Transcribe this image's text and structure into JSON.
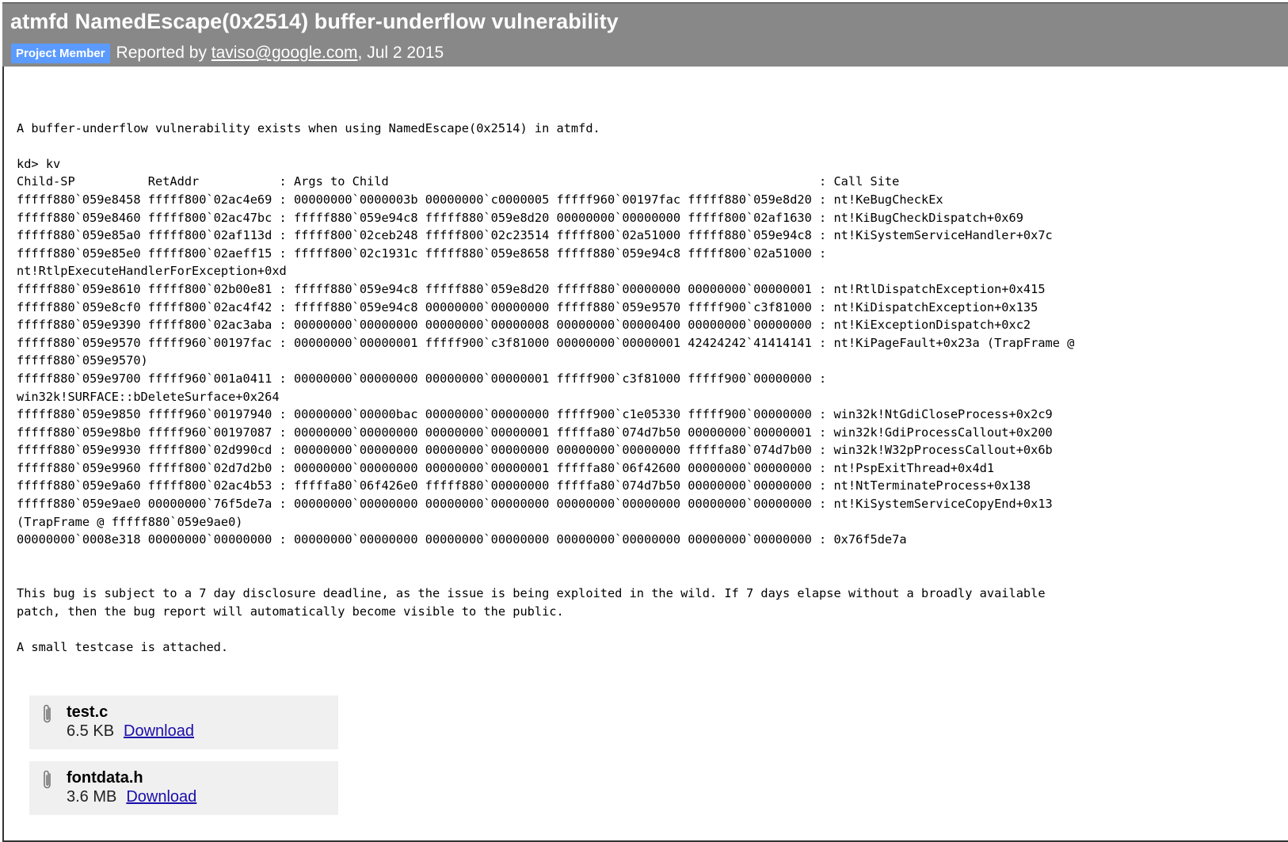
{
  "header": {
    "title": "atmfd NamedEscape(0x2514) buffer-underflow vulnerability",
    "badge": "Project Member",
    "reported_by_prefix": "Reported by",
    "reporter": "taviso@google.com",
    "date_suffix": ", Jul 2 2015"
  },
  "report": {
    "lines": [
      "",
      "A buffer-underflow vulnerability exists when using NamedEscape(0x2514) in atmfd.",
      "",
      "kd> kv",
      "Child-SP          RetAddr           : Args to Child                                                           : Call Site",
      "fffff880`059e8458 fffff800`02ac4e69 : 00000000`0000003b 00000000`c0000005 fffff960`00197fac fffff880`059e8d20 : nt!KeBugCheckEx",
      "fffff880`059e8460 fffff800`02ac47bc : fffff880`059e94c8 fffff880`059e8d20 00000000`00000000 fffff800`02af1630 : nt!KiBugCheckDispatch+0x69",
      "fffff880`059e85a0 fffff800`02af113d : fffff800`02ceb248 fffff800`02c23514 fffff800`02a51000 fffff880`059e94c8 : nt!KiSystemServiceHandler+0x7c",
      "fffff880`059e85e0 fffff800`02aeff15 : fffff800`02c1931c fffff880`059e8658 fffff880`059e94c8 fffff800`02a51000 :",
      "nt!RtlpExecuteHandlerForException+0xd",
      "fffff880`059e8610 fffff800`02b00e81 : fffff880`059e94c8 fffff880`059e8d20 fffff880`00000000 00000000`00000001 : nt!RtlDispatchException+0x415",
      "fffff880`059e8cf0 fffff800`02ac4f42 : fffff880`059e94c8 00000000`00000000 fffff880`059e9570 fffff900`c3f81000 : nt!KiDispatchException+0x135",
      "fffff880`059e9390 fffff800`02ac3aba : 00000000`00000000 00000000`00000008 00000000`00000400 00000000`00000000 : nt!KiExceptionDispatch+0xc2",
      "fffff880`059e9570 fffff960`00197fac : 00000000`00000001 fffff900`c3f81000 00000000`00000001 42424242`41414141 : nt!KiPageFault+0x23a (TrapFrame @",
      "fffff880`059e9570)",
      "fffff880`059e9700 fffff960`001a0411 : 00000000`00000000 00000000`00000001 fffff900`c3f81000 fffff900`00000000 :",
      "win32k!SURFACE::bDeleteSurface+0x264",
      "fffff880`059e9850 fffff960`00197940 : 00000000`00000bac 00000000`00000000 fffff900`c1e05330 fffff900`00000000 : win32k!NtGdiCloseProcess+0x2c9",
      "fffff880`059e98b0 fffff960`00197087 : 00000000`00000000 00000000`00000001 fffffa80`074d7b50 00000000`00000001 : win32k!GdiProcessCallout+0x200",
      "fffff880`059e9930 fffff800`02d990cd : 00000000`00000000 00000000`00000000 00000000`00000000 fffffa80`074d7b00 : win32k!W32pProcessCallout+0x6b",
      "fffff880`059e9960 fffff800`02d7d2b0 : 00000000`00000000 00000000`00000001 fffffa80`06f42600 00000000`00000000 : nt!PspExitThread+0x4d1",
      "fffff880`059e9a60 fffff800`02ac4b53 : fffffa80`06f426e0 fffff880`00000000 fffffa80`074d7b50 00000000`00000000 : nt!NtTerminateProcess+0x138",
      "fffff880`059e9ae0 00000000`76f5de7a : 00000000`00000000 00000000`00000000 00000000`00000000 00000000`00000000 : nt!KiSystemServiceCopyEnd+0x13",
      "(TrapFrame @ fffff880`059e9ae0)",
      "00000000`0008e318 00000000`00000000 : 00000000`00000000 00000000`00000000 00000000`00000000 00000000`00000000 : 0x76f5de7a",
      "",
      "",
      "This bug is subject to a 7 day disclosure deadline, as the issue is being exploited in the wild. If 7 days elapse without a broadly available",
      "patch, then the bug report will automatically become visible to the public.",
      "",
      "A small testcase is attached."
    ]
  },
  "attachments": [
    {
      "name": "test.c",
      "size": "6.5 KB",
      "download_label": "Download",
      "icon": "paperclip-icon"
    },
    {
      "name": "fontdata.h",
      "size": "3.6 MB",
      "download_label": "Download",
      "icon": "paperclip-icon"
    }
  ]
}
